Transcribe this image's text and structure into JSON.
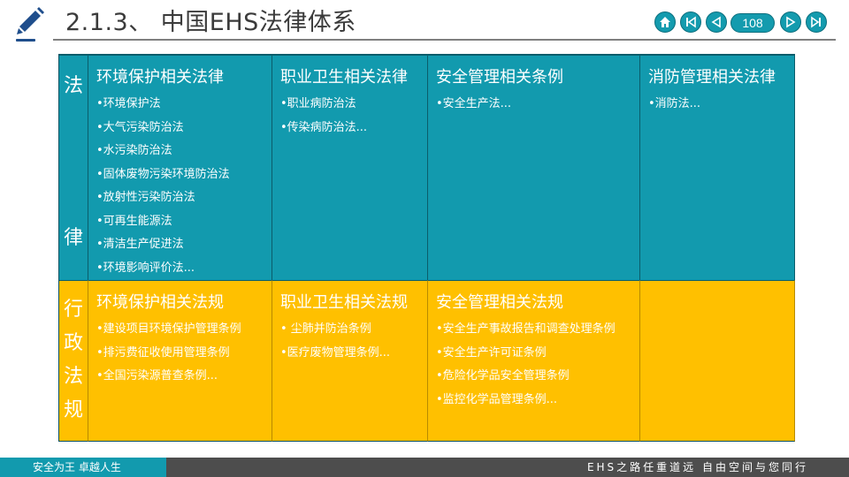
{
  "header": {
    "title": "2.1.3、 中国EHS法律体系",
    "page_number": "108",
    "nav_icons": [
      "home-icon",
      "first-page-icon",
      "previous-page-icon",
      "next-page-icon",
      "last-page-icon"
    ]
  },
  "colors": {
    "teal": "#129aae",
    "gold": "#ffc000",
    "footer_gray": "#4d4d4d"
  },
  "laws": {
    "side_label": [
      "法",
      "律"
    ],
    "columns": [
      {
        "heading": "环境保护相关法律",
        "items": [
          "•环境保护法",
          "•大气污染防治法",
          "•水污染防治法",
          "•固体废物污染环境防治法",
          "•放射性污染防治法",
          "•可再生能源法",
          "•清洁生产促进法",
          "•环境影响评价法..."
        ]
      },
      {
        "heading": "职业卫生相关法律",
        "items": [
          "•职业病防治法",
          "•传染病防治法..."
        ]
      },
      {
        "heading": "安全管理相关条例",
        "items": [
          "•安全生产法..."
        ]
      },
      {
        "heading": "消防管理相关法律",
        "items": [
          "•消防法..."
        ]
      }
    ]
  },
  "regulations": {
    "side_label": [
      "行",
      "政",
      "法",
      "规"
    ],
    "columns": [
      {
        "heading": "环境保护相关法规",
        "items": [
          "•建设项目环境保护管理条例",
          "•排污费征收使用管理条例",
          "•全国污染源普查条例..."
        ]
      },
      {
        "heading": "职业卫生相关法规",
        "items": [
          "• 尘肺并防治条例",
          "•医疗废物管理条例..."
        ]
      },
      {
        "heading": "安全管理相关法规",
        "items": [
          "•安全生产事故报告和调查处理条例",
          "•安全生产许可证条例",
          "•危险化学品安全管理条例",
          "•监控化学品管理条例..."
        ]
      },
      {
        "heading": "",
        "items": []
      }
    ]
  },
  "footer": {
    "left": "安全为王 卓越人生",
    "right": "EHS之路任重道远   自由空间与您同行"
  }
}
